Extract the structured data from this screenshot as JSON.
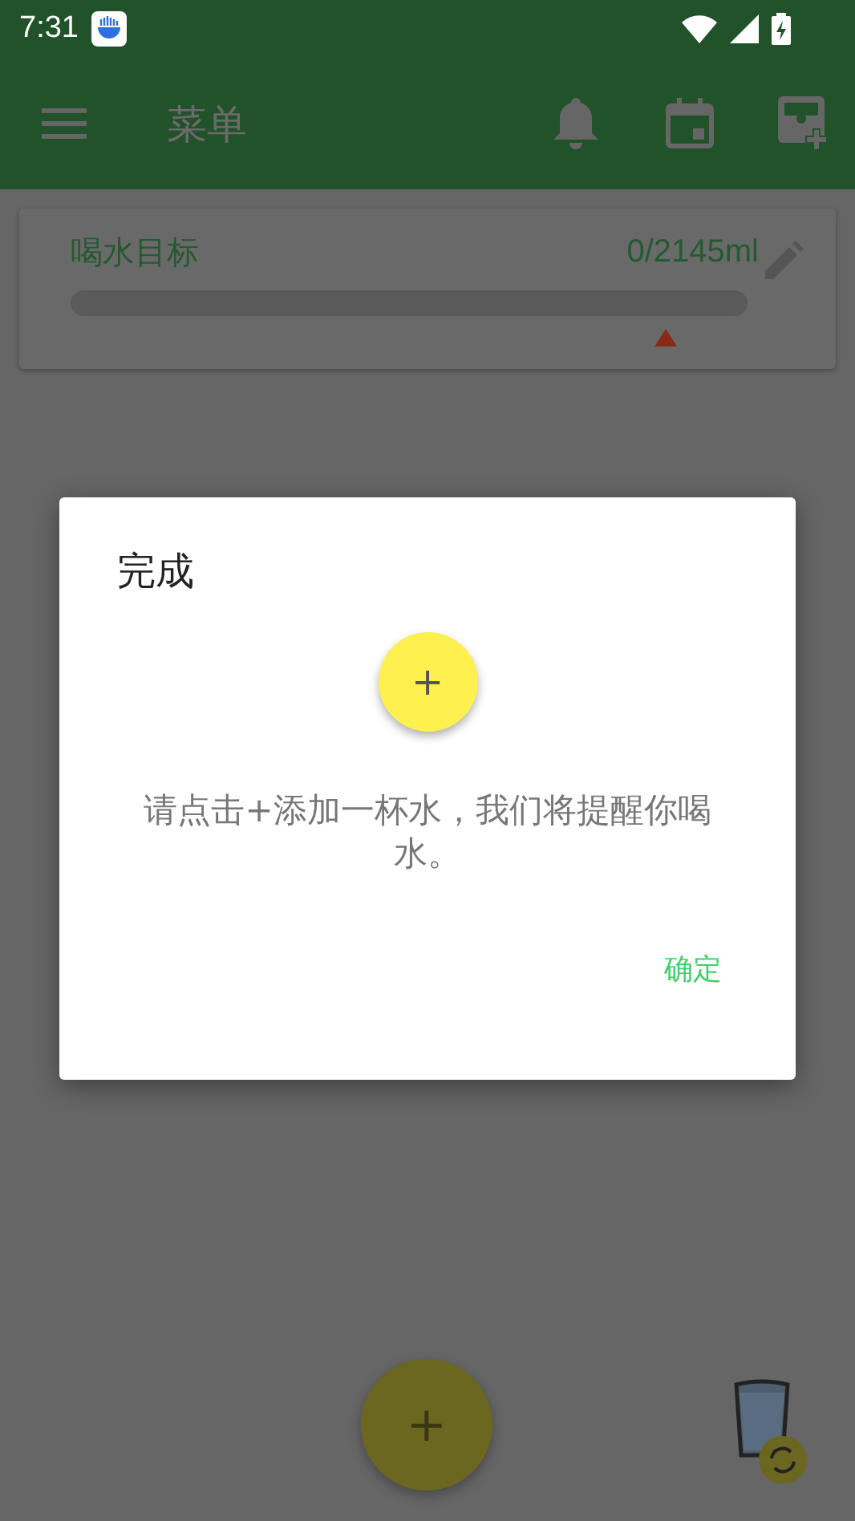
{
  "status_bar": {
    "time": "7:31"
  },
  "toolbar": {
    "title": "菜单"
  },
  "goal_card": {
    "title": "喝水目标",
    "amount": "0/2145ml",
    "level": 0
  },
  "dialog": {
    "title": "完成",
    "add_symbol": "+",
    "message": "请点击+添加一杯水，我们将提醒你喝水。",
    "buttons": [
      "确定"
    ]
  },
  "fab": {
    "symbol": "+"
  }
}
